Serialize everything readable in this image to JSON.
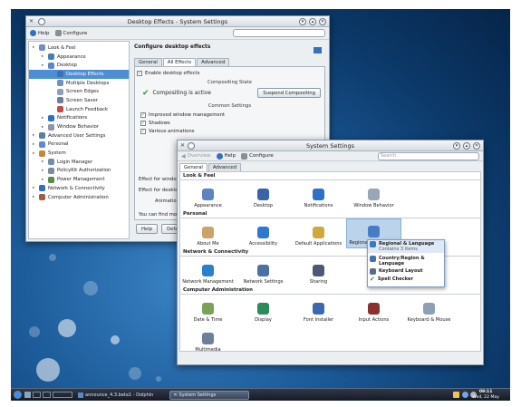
{
  "desktop_effects": {
    "title": "Desktop Effects - System Settings",
    "help_label": "Help",
    "configure_label": "Configure",
    "tree": [
      {
        "label": "Look & Feel",
        "level": 0,
        "icon": "look-feel-icon"
      },
      {
        "label": "Appearance",
        "level": 1,
        "icon": "appearance-icon"
      },
      {
        "label": "Desktop",
        "level": 1,
        "icon": "desktop-icon"
      },
      {
        "label": "Desktop Effects",
        "level": 2,
        "icon": "desktop-effects-icon",
        "selected": true
      },
      {
        "label": "Multiple Desktops",
        "level": 2,
        "icon": "multiple-desktops-icon"
      },
      {
        "label": "Screen Edges",
        "level": 2,
        "icon": "screen-edges-icon"
      },
      {
        "label": "Screen Saver",
        "level": 2,
        "icon": "screen-saver-icon"
      },
      {
        "label": "Launch Feedback",
        "level": 2,
        "icon": "launch-feedback-icon"
      },
      {
        "label": "Notifications",
        "level": 1,
        "icon": "notifications-icon"
      },
      {
        "label": "Window Behavior",
        "level": 1,
        "icon": "window-behavior-icon"
      },
      {
        "label": "Advanced User Settings",
        "level": 0,
        "icon": "advanced-user-icon"
      },
      {
        "label": "Personal",
        "level": 0,
        "icon": "personal-icon"
      },
      {
        "label": "System",
        "level": 0,
        "icon": "system-icon"
      },
      {
        "label": "Login Manager",
        "level": 1,
        "icon": "login-manager-icon"
      },
      {
        "label": "PolicyKit Authorization",
        "level": 1,
        "icon": "policykit-icon"
      },
      {
        "label": "Power Management",
        "level": 1,
        "icon": "power-icon"
      },
      {
        "label": "Network & Connectivity",
        "level": 0,
        "icon": "network-icon"
      },
      {
        "label": "Computer Administration",
        "level": 0,
        "icon": "admin-icon"
      }
    ],
    "heading": "Configure desktop effects",
    "tabs": [
      "General",
      "All Effects",
      "Advanced"
    ],
    "enable_label": "Enable desktop effects",
    "compositing_state_label": "Compositing State",
    "compositing_active": "Compositing is active",
    "suspend_button": "Suspend Compositing",
    "common_settings_label": "Common Settings",
    "improved_wm": "Improved window management",
    "shadows": "Shadows",
    "various_animations": "Various animations",
    "effect_window_switch": "Effect for window switchi",
    "effect_desktop_switch": "Effect for desktop switchi",
    "animation_speed": "Animation spe",
    "find_more": "You can find more effects,",
    "help_button": "Help",
    "defaults_button": "Defaults"
  },
  "system_settings": {
    "title": "System Settings",
    "overview_label": "Overview",
    "help_label": "Help",
    "configure_label": "Configure",
    "search_placeholder": "Search",
    "tabs": [
      "General",
      "Advanced"
    ],
    "sections": [
      {
        "title": "Look & Feel",
        "items": [
          {
            "label": "Appearance",
            "icon": "appearance-icon"
          },
          {
            "label": "Desktop",
            "icon": "desktop-icon"
          },
          {
            "label": "Notifications",
            "icon": "notifications-icon"
          },
          {
            "label": "Window Behavior",
            "icon": "window-behavior-icon"
          }
        ]
      },
      {
        "title": "Personal",
        "items": [
          {
            "label": "About Me",
            "icon": "about-me-icon"
          },
          {
            "label": "Accessibility",
            "icon": "accessibility-icon"
          },
          {
            "label": "Default Applications",
            "icon": "default-apps-icon"
          },
          {
            "label": "Regional & Language",
            "icon": "regional-icon",
            "highlight": true
          }
        ]
      },
      {
        "title": "Network & Connectivity",
        "items": [
          {
            "label": "Network Management",
            "icon": "network-management-icon"
          },
          {
            "label": "Network Settings",
            "icon": "network-settings-icon"
          },
          {
            "label": "Sharing",
            "icon": "sharing-icon"
          }
        ]
      },
      {
        "title": "Computer Administration",
        "items": [
          {
            "label": "Date & Time",
            "icon": "date-time-icon"
          },
          {
            "label": "Display",
            "icon": "display-icon"
          },
          {
            "label": "Font Installer",
            "icon": "font-installer-icon"
          },
          {
            "label": "Input Actions",
            "icon": "input-actions-icon"
          },
          {
            "label": "Keyboard & Mouse",
            "icon": "keyboard-mouse-icon"
          },
          {
            "label": "Multimedia",
            "icon": "multimedia-icon"
          }
        ]
      }
    ],
    "popup": {
      "title": "Regional & Language",
      "subtitle": "Contains 3 items",
      "items": [
        "Country/Region & Language",
        "Keyboard Layout",
        "Spell Checker"
      ]
    }
  },
  "taskbar": {
    "task1": "announce_4.3.beta1 - Dolphin",
    "task2": "System Settings",
    "time": "09:11",
    "date": "Wed, 22 May"
  }
}
